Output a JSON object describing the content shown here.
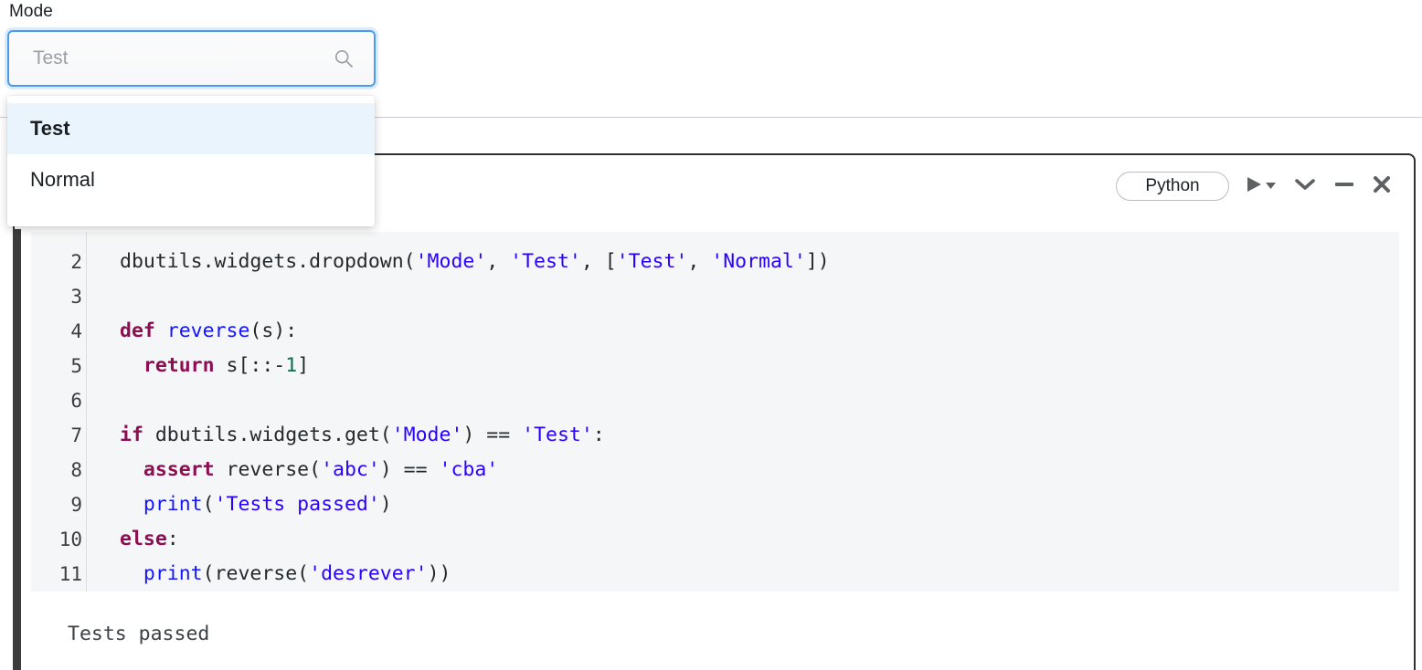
{
  "widget": {
    "label": "Mode",
    "input_value": "",
    "placeholder": "Test",
    "search_icon": "search-icon",
    "options": [
      {
        "label": "Test",
        "selected": true
      },
      {
        "label": "Normal",
        "selected": false
      }
    ]
  },
  "cell": {
    "language": "Python",
    "toolbar": {
      "run_icon": "play-icon",
      "run_caret_icon": "caret-down-icon",
      "collapse_icon": "chevron-down-icon",
      "minimize_icon": "minus-icon",
      "close_icon": "close-icon"
    },
    "code_lines": [
      {
        "number": "2",
        "tokens": [
          {
            "t": "dbutils.widgets.dropdown(",
            "c": "pl"
          },
          {
            "t": "'Mode'",
            "c": "str"
          },
          {
            "t": ", ",
            "c": "pl"
          },
          {
            "t": "'Test'",
            "c": "str"
          },
          {
            "t": ", [",
            "c": "pl"
          },
          {
            "t": "'Test'",
            "c": "str"
          },
          {
            "t": ", ",
            "c": "pl"
          },
          {
            "t": "'Normal'",
            "c": "str"
          },
          {
            "t": "])",
            "c": "pl"
          }
        ]
      },
      {
        "number": "3",
        "tokens": []
      },
      {
        "number": "4",
        "tokens": [
          {
            "t": "def",
            "c": "kw"
          },
          {
            "t": " ",
            "c": "pl"
          },
          {
            "t": "reverse",
            "c": "fn"
          },
          {
            "t": "(s):",
            "c": "pl"
          }
        ]
      },
      {
        "number": "5",
        "tokens": [
          {
            "t": "  ",
            "c": "pl"
          },
          {
            "t": "return",
            "c": "kw"
          },
          {
            "t": " s[::-",
            "c": "pl"
          },
          {
            "t": "1",
            "c": "num"
          },
          {
            "t": "]",
            "c": "pl"
          }
        ]
      },
      {
        "number": "6",
        "tokens": []
      },
      {
        "number": "7",
        "tokens": [
          {
            "t": "if",
            "c": "kw"
          },
          {
            "t": " dbutils.widgets.get(",
            "c": "pl"
          },
          {
            "t": "'Mode'",
            "c": "str"
          },
          {
            "t": ") == ",
            "c": "pl"
          },
          {
            "t": "'Test'",
            "c": "str"
          },
          {
            "t": ":",
            "c": "pl"
          }
        ]
      },
      {
        "number": "8",
        "tokens": [
          {
            "t": "  ",
            "c": "pl"
          },
          {
            "t": "assert",
            "c": "kw"
          },
          {
            "t": " reverse(",
            "c": "pl"
          },
          {
            "t": "'abc'",
            "c": "str"
          },
          {
            "t": ") == ",
            "c": "pl"
          },
          {
            "t": "'cba'",
            "c": "str"
          }
        ]
      },
      {
        "number": "9",
        "tokens": [
          {
            "t": "  ",
            "c": "pl"
          },
          {
            "t": "print",
            "c": "fn"
          },
          {
            "t": "(",
            "c": "pl"
          },
          {
            "t": "'Tests passed'",
            "c": "str"
          },
          {
            "t": ")",
            "c": "pl"
          }
        ]
      },
      {
        "number": "10",
        "tokens": [
          {
            "t": "else",
            "c": "kw"
          },
          {
            "t": ":",
            "c": "pl"
          }
        ]
      },
      {
        "number": "11",
        "tokens": [
          {
            "t": "  ",
            "c": "pl"
          },
          {
            "t": "print",
            "c": "fn"
          },
          {
            "t": "(reverse(",
            "c": "pl"
          },
          {
            "t": "'desrever'",
            "c": "str"
          },
          {
            "t": "))",
            "c": "pl"
          }
        ]
      }
    ],
    "output": "Tests passed"
  },
  "colors": {
    "focus_border": "#4a9aef",
    "menu_selected_bg": "#eaf4fd",
    "cell_border": "#2f3034",
    "cell_selected_bar": "#3c3c3c",
    "code_bg": "#f5f6f7",
    "keyword": "#8b0f52",
    "string": "#2a00ff",
    "function": "#1414ff",
    "number": "#0f6b4a"
  }
}
